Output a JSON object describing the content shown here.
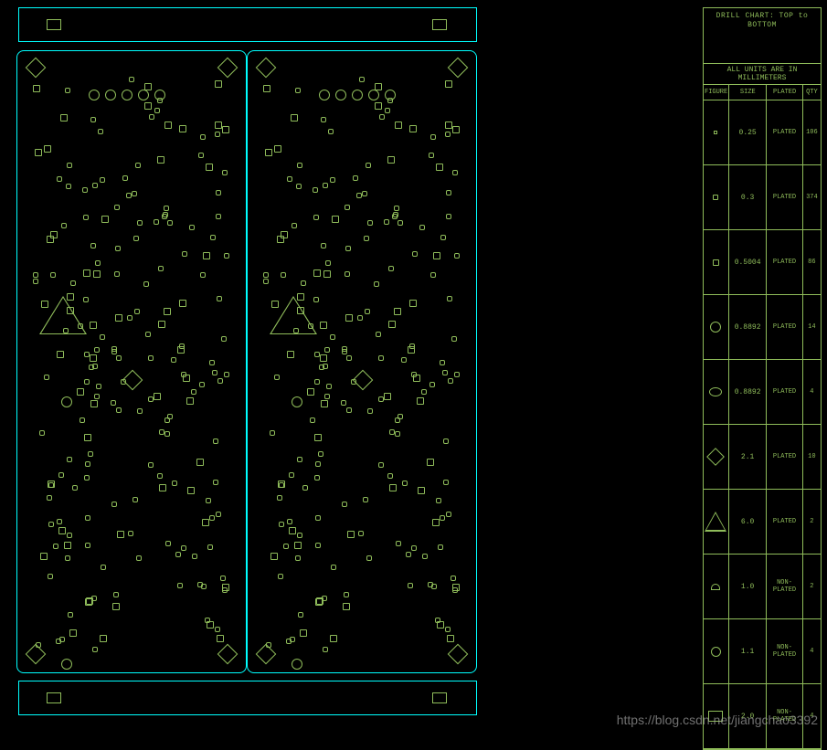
{
  "chart": {
    "title": "DRILL CHART: TOP to BOTTOM",
    "subtitle": "ALL UNITS ARE IN MILLIMETERS",
    "headers": {
      "figure": "FIGURE",
      "size": "SIZE",
      "plated": "PLATED",
      "qty": "QTY"
    },
    "rows": [
      {
        "figure": "dot",
        "size": "0.25",
        "plated": "PLATED",
        "qty": "106"
      },
      {
        "figure": "sq3",
        "size": "0.3",
        "plated": "PLATED",
        "qty": "374"
      },
      {
        "figure": "sq5",
        "size": "0.5004",
        "plated": "PLATED",
        "qty": "86"
      },
      {
        "figure": "circ",
        "size": "0.8892",
        "plated": "PLATED",
        "qty": "14"
      },
      {
        "figure": "oval",
        "size": "0.8892",
        "plated": "PLATED",
        "qty": "4"
      },
      {
        "figure": "diamond",
        "size": "2.1",
        "plated": "PLATED",
        "qty": "10"
      },
      {
        "figure": "tri",
        "size": "6.0",
        "plated": "PLATED",
        "qty": "2"
      },
      {
        "figure": "half",
        "size": "1.0",
        "plated": "NON-PLATED",
        "qty": "2"
      },
      {
        "figure": "circ2",
        "size": "1.1",
        "plated": "NON-PLATED",
        "qty": "4"
      },
      {
        "figure": "rect",
        "size": "2.0",
        "plated": "NON-PLATED",
        "qty": "4"
      }
    ]
  },
  "watermark": "https://blog.csdn.net/jiangchao3392"
}
